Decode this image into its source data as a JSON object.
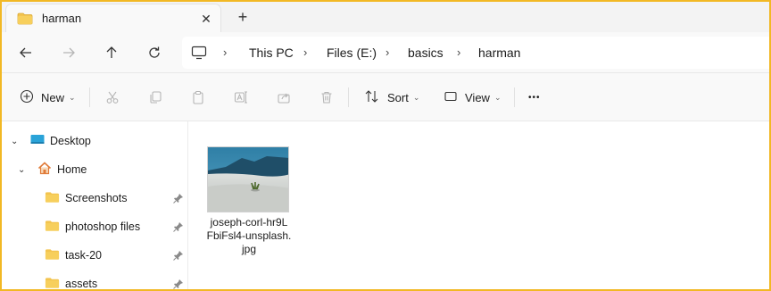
{
  "tab": {
    "title": "harman",
    "close_glyph": "✕",
    "newtab_glyph": "+"
  },
  "nav": {
    "back": "back-arrow-icon",
    "forward": "forward-arrow-icon",
    "up": "up-arrow-icon",
    "refresh": "refresh-icon"
  },
  "breadcrumb": [
    "This PC",
    "Files (E:)",
    "basics",
    "harman"
  ],
  "toolbar": {
    "new_label": "New",
    "sort_label": "Sort",
    "view_label": "View",
    "more_glyph": "•••"
  },
  "sidebar": {
    "items": [
      {
        "label": "Desktop",
        "expanded": true,
        "pinned": false
      },
      {
        "label": "Home",
        "expanded": true,
        "pinned": false
      },
      {
        "label": "Screenshots",
        "pinned": true
      },
      {
        "label": "photoshop files",
        "pinned": true
      },
      {
        "label": "task-20",
        "pinned": true
      },
      {
        "label": "assets",
        "pinned": true
      }
    ]
  },
  "files": [
    {
      "name_lines": [
        "joseph-corl-hr9L",
        "FbiFsl4-unsplash.",
        "jpg"
      ]
    }
  ],
  "colors": {
    "accent_border": "#f2b824",
    "folder": "#f3c44f",
    "desktop": "#2aa3d8"
  }
}
